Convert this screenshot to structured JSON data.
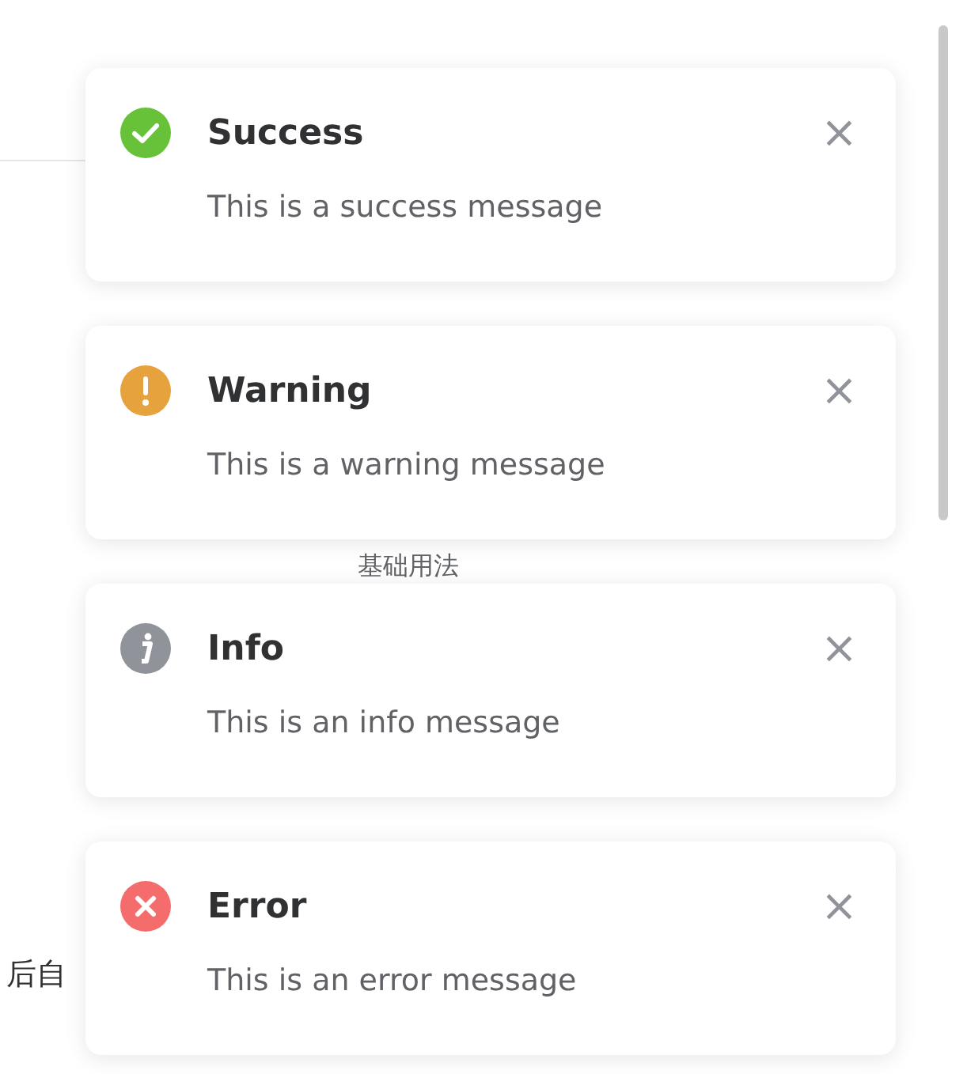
{
  "background": {
    "section_heading": "基础用法",
    "partial_text": "后自"
  },
  "notifications": [
    {
      "kind": "success",
      "title": "Success",
      "message": "This is a success message",
      "close": "×"
    },
    {
      "kind": "warning",
      "title": "Warning",
      "message": "This is a warning message",
      "close": "×"
    },
    {
      "kind": "info",
      "title": "Info",
      "message": "This is an info message",
      "close": "×"
    },
    {
      "kind": "error",
      "title": "Error",
      "message": "This is an error message",
      "close": "×"
    }
  ]
}
